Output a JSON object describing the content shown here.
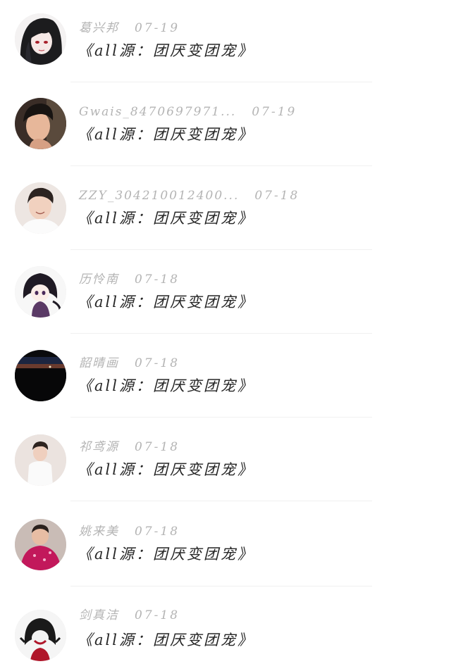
{
  "comments": [
    {
      "avatar": "avatar-anime-dark-hair",
      "username": "葛兴邦",
      "date": "07-19",
      "text": "《all源：团厌变团宠》"
    },
    {
      "avatar": "avatar-young-man-photo",
      "username": "Gwais_8470697971...",
      "date": "07-19",
      "text": "《all源：团厌变团宠》"
    },
    {
      "avatar": "avatar-smiling-boy-photo",
      "username": "ZZY_304210012400...",
      "date": "07-18",
      "text": "《all源：团厌变团宠》"
    },
    {
      "avatar": "avatar-anime-chibi",
      "username": "历怜南",
      "date": "07-18",
      "text": "《all源：团厌变团宠》"
    },
    {
      "avatar": "avatar-night-sky",
      "username": "韶晴画",
      "date": "07-18",
      "text": "《all源：团厌变团宠》"
    },
    {
      "avatar": "avatar-boy-white-shirt",
      "username": "祁鸢源",
      "date": "07-18",
      "text": "《all源：团厌变团宠》"
    },
    {
      "avatar": "avatar-child-pink-jacket",
      "username": "姚来美",
      "date": "07-18",
      "text": "《all源：团厌变团宠》"
    },
    {
      "avatar": "avatar-anime-cartoon",
      "username": "剑真洁",
      "date": "07-18",
      "text": "《all源：团厌变团宠》"
    }
  ],
  "colors": {
    "username": "#b4b4b4",
    "text": "#262626",
    "divider": "#f0f0f0",
    "background": "#ffffff"
  }
}
